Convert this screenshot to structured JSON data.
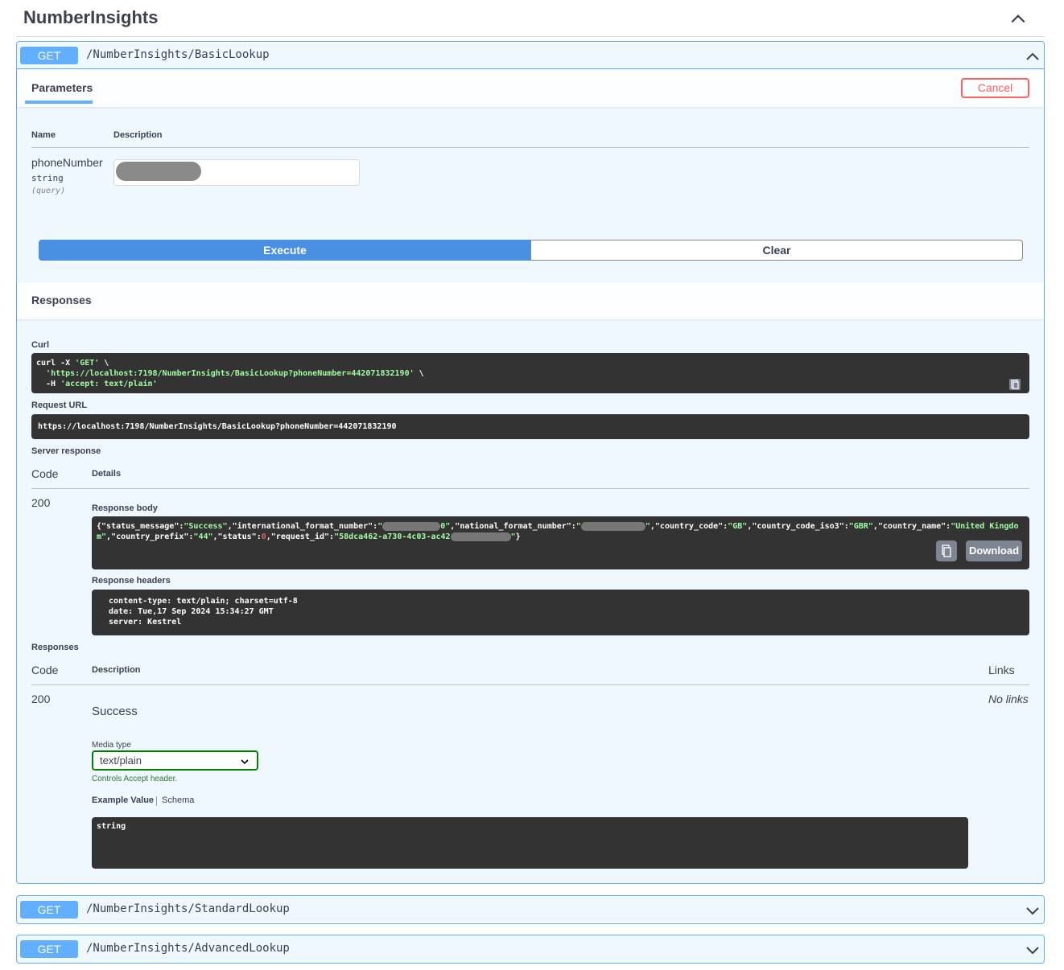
{
  "tag": {
    "title": "NumberInsights"
  },
  "operations": [
    {
      "method": "GET",
      "path": "/NumberInsights/BasicLookup"
    },
    {
      "method": "GET",
      "path": "/NumberInsights/StandardLookup"
    },
    {
      "method": "GET",
      "path": "/NumberInsights/AdvancedLookup"
    }
  ],
  "params_section": {
    "tab_label": "Parameters",
    "cancel_label": "Cancel",
    "col_name": "Name",
    "col_description": "Description",
    "param": {
      "name": "phoneNumber",
      "type": "string",
      "in": "(query)"
    }
  },
  "actions": {
    "execute_label": "Execute",
    "clear_label": "Clear"
  },
  "responses_section": {
    "title": "Responses",
    "curl_label": "Curl",
    "curl_line1_a": "curl -X ",
    "curl_line1_b": "'GET'",
    "curl_line1_c": " \\",
    "curl_line2_a": "  ",
    "curl_line2_b": "'https://localhost:7198/NumberInsights/BasicLookup?phoneNumber=442071832190'",
    "curl_line2_c": " \\",
    "curl_line3_a": "  -H ",
    "curl_line3_b": "'accept: text/plain'",
    "request_url_label": "Request URL",
    "request_url": "https://localhost:7198/NumberInsights/BasicLookup?phoneNumber=442071832190",
    "server_response_label": "Server response",
    "col_code": "Code",
    "col_details": "Details",
    "status_code": "200",
    "response_body_label": "Response body",
    "body": {
      "p1": "{\"status_message\":",
      "s1": "\"Success\"",
      "p2": ",\"international_format_number\":",
      "s2a": "\"",
      "s2b": "0\"",
      "p3": ",\"national_format_number\":",
      "s3a": "\"",
      "s3b": "\"",
      "p4": ",\"country_code\":",
      "s4": "\"GB\"",
      "p5": ",\"country_code_iso3\":",
      "s5": "\"GBR\"",
      "p6": ",\"country_name\":",
      "s6": "\"United Kingdom\"",
      "p7": ",\"country_prefix\":",
      "s7": "\"44\"",
      "p8": ",\"status\":",
      "n8": "0",
      "p9": ",\"request_id\":",
      "s9a": "\"58dca462-a730-4c03-ac42",
      "s9b": "\"",
      "p10": "}"
    },
    "download_label": "Download",
    "response_headers_label": "Response headers",
    "headers": [
      " content-type: text/plain; charset=utf-8 ",
      " date: Tue,17 Sep 2024 15:34:27 GMT ",
      " server: Kestrel "
    ],
    "responses_label": "Responses",
    "col_code2": "Code",
    "col_description": "Description",
    "col_links": "Links",
    "resp_code": "200",
    "no_links": "No links",
    "resp_description": "Success",
    "media_type_label": "Media type",
    "media_type_value": "text/plain",
    "controls_text": "Controls Accept header.",
    "example_value_tab": "Example Value",
    "schema_tab": "Schema",
    "example_value": "string"
  }
}
